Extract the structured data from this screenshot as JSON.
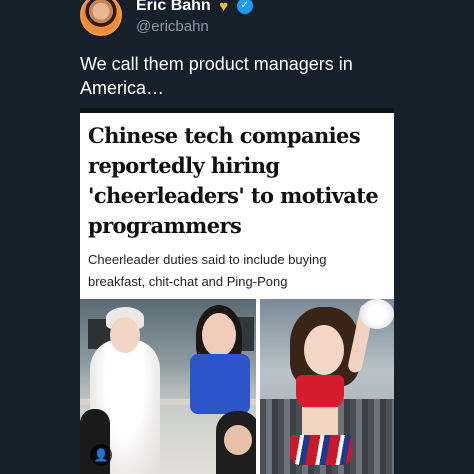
{
  "author": {
    "name": "Eric Bahn",
    "handle": "@ericbahn",
    "badges": [
      "heart-badge-icon",
      "verified-badge-icon"
    ]
  },
  "tweet": {
    "text": "We call them product managers in America…"
  },
  "article_card": {
    "headline": "Chinese tech companies reportedly hiring 'cheerleaders' to motivate programmers",
    "subheadline": "Cheerleader duties said to include buying breakfast, chit-chat and Ping-Pong",
    "image_caption_icon": "user-icon"
  },
  "colors": {
    "background": "#15202b",
    "verified": "#1d9bf0",
    "heart_badge": "#f5c518",
    "text_primary": "#ffffff",
    "text_secondary": "#8b98a5"
  }
}
